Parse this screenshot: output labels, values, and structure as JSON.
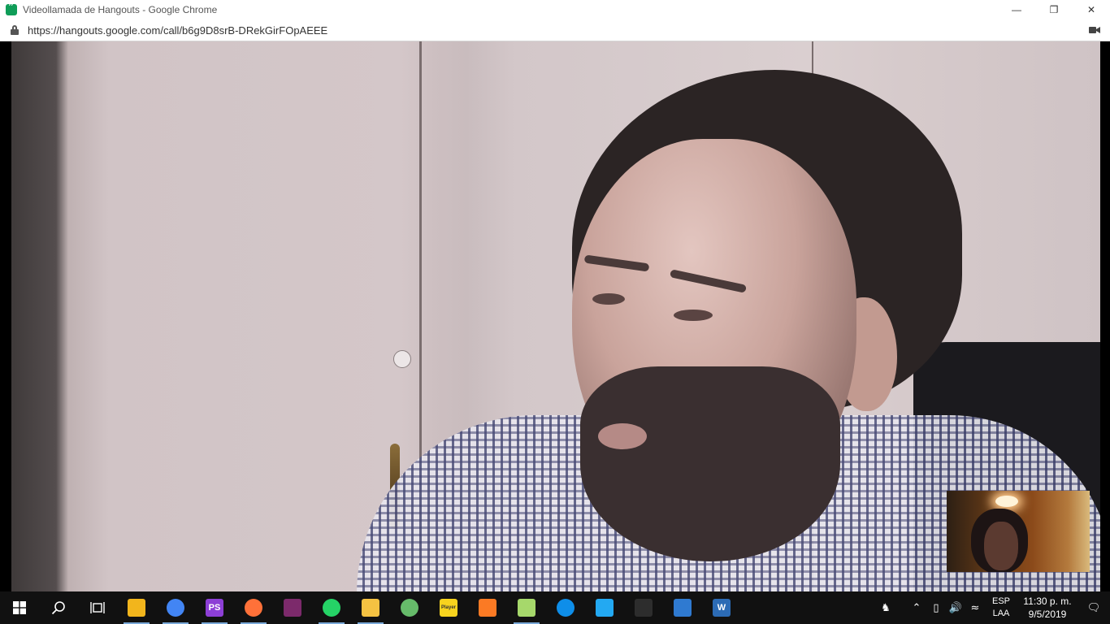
{
  "window": {
    "title": "Videollamada de Hangouts - Google Chrome",
    "controls": {
      "minimize": "—",
      "restore": "❐",
      "close": "✕"
    }
  },
  "address": {
    "url": "https://hangouts.google.com/call/b6g9D8srB-DRekGirFOpAEEE"
  },
  "video_call": {
    "main_feed": "remote-participant-video",
    "self_view": "local-camera-preview"
  },
  "taskbar": {
    "start_icon": "windows-logo-icon",
    "search_icon": "search-icon",
    "taskview_icon": "task-view-icon",
    "apps": [
      {
        "name": "yellow-app",
        "label": "",
        "color": "#f2b51c",
        "active": true
      },
      {
        "name": "chrome",
        "label": "",
        "color": "#4285f4",
        "active": true
      },
      {
        "name": "phpstorm",
        "label": "PS",
        "color": "#8d3fd6",
        "active": true
      },
      {
        "name": "firefox",
        "label": "",
        "color": "#ff7139",
        "active": true
      },
      {
        "name": "winrar",
        "label": "",
        "color": "#7c2a6b",
        "active": false
      },
      {
        "name": "whatsapp",
        "label": "",
        "color": "#25d366",
        "active": true
      },
      {
        "name": "file-explorer",
        "label": "",
        "color": "#f5c242",
        "active": true
      },
      {
        "name": "atom",
        "label": "",
        "color": "#66bb6a",
        "active": false
      },
      {
        "name": "player",
        "label": "Player",
        "color": "#f7d31e",
        "active": false
      },
      {
        "name": "xampp",
        "label": "",
        "color": "#fb7a24",
        "active": false
      },
      {
        "name": "notepad-plus",
        "label": "",
        "color": "#a6d86b",
        "active": true
      },
      {
        "name": "teamviewer",
        "label": "",
        "color": "#0e8ee9",
        "active": false
      },
      {
        "name": "vscode",
        "label": "",
        "color": "#23a9f2",
        "active": false
      },
      {
        "name": "terminal",
        "label": "",
        "color": "#2d2d2d",
        "active": false
      },
      {
        "name": "app-window",
        "label": "",
        "color": "#2f7ad1",
        "active": false
      },
      {
        "name": "word-editor",
        "label": "W",
        "color": "#2c6bb5",
        "active": false
      }
    ],
    "tray": {
      "lang_line1": "ESP",
      "lang_line2": "LAA",
      "time": "11:30 p. m.",
      "date": "9/5/2019"
    }
  }
}
